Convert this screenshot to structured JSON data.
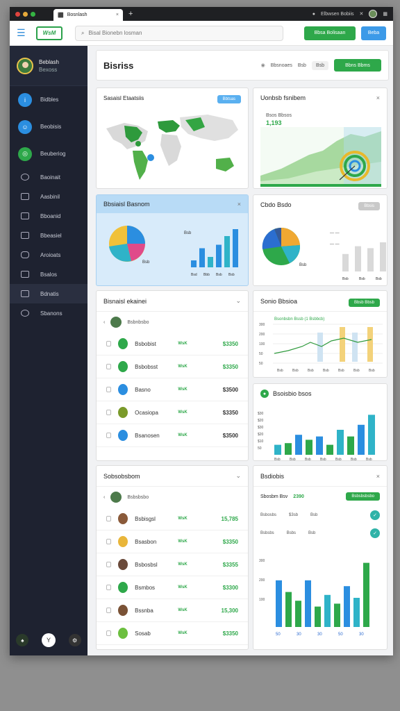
{
  "browser": {
    "tab_title": "Bosnlash",
    "tab_close": "×",
    "new_tab": "+",
    "address_text": "Elbwsen Bobiis"
  },
  "header": {
    "logo_text": "WsM",
    "search_placeholder": "Bisal Bionebn losman",
    "primary_button": "Bbsa Bolisaan",
    "secondary_button": "Beba"
  },
  "sidebar": {
    "user_name": "Beblash",
    "user_role": "Bexoss",
    "items": [
      {
        "label": "Bidbles",
        "icon": "info-icon",
        "color": "#2b8ee0"
      },
      {
        "label": "Beobisis",
        "icon": "users-icon",
        "color": "#2b8ee0"
      },
      {
        "label": "Beuberiog",
        "icon": "chart-icon",
        "color": "#2ea84a"
      },
      {
        "label": "Baoinait",
        "icon": "message-icon"
      },
      {
        "label": "Aasbinil",
        "icon": "card-icon"
      },
      {
        "label": "Bboanid",
        "icon": "file-icon"
      },
      {
        "label": "Bbeasiel",
        "icon": "calendar-icon"
      },
      {
        "label": "Aroioats",
        "icon": "lock-icon"
      },
      {
        "label": "Bsalos",
        "icon": "folder-icon"
      },
      {
        "label": "Bdnatis",
        "icon": "doc-icon"
      },
      {
        "label": "Sbanons",
        "icon": "settings-icon"
      }
    ]
  },
  "topcard": {
    "title": "Bisriss",
    "status": "Bbsnoaes",
    "chip1": "Bsb",
    "chip2": "Bsb",
    "button": "Bbns Bbms"
  },
  "map_card": {
    "title": "Sasaisl Etaatsiis",
    "button": "Bbtsas"
  },
  "area_card": {
    "title": "Uonbsb fsnibem",
    "stat_label": "Bsos Bbsos",
    "stat_value": "1,193",
    "close": "×"
  },
  "pie1_card": {
    "title": "Bbsiaisl Basnom",
    "close": "×",
    "label_top": "Bsb",
    "label_pie": "Bsb",
    "ticks": [
      "Bsd",
      "Bbb",
      "Bsb",
      "Bsb"
    ]
  },
  "pie2_card": {
    "title": "Cbdo Bsdo",
    "button": "Bbsis",
    "label_pie": "Bsb",
    "ticks": [
      "Bsb",
      "Bsb",
      "Bsb"
    ]
  },
  "list1": {
    "title": "Bisnaisl ekainei",
    "sub_label": "Bsbnbsbo",
    "rows": [
      {
        "name": "Bsbobist",
        "badge": "WsK",
        "amount": "$3350",
        "color": "#2ea84a",
        "dark": false
      },
      {
        "name": "Bsbobsst",
        "badge": "WsK",
        "amount": "$3350",
        "color": "#2ea84a",
        "dark": false
      },
      {
        "name": "Basno",
        "badge": "WsK",
        "amount": "$3500",
        "color": "#2b8ee0",
        "dark": true
      },
      {
        "name": "Ocasiopa",
        "badge": "WsK",
        "amount": "$3350",
        "color": "#7a9a2a",
        "dark": true
      },
      {
        "name": "Bsanosen",
        "badge": "WsK",
        "amount": "$3500",
        "color": "#2b8ee0",
        "dark": true
      }
    ]
  },
  "combo_card": {
    "title": "Sonio Bbsioa",
    "button": "Bbsb Bbsb",
    "legend": "Bsonbsbn Bssb (1 Bsbbcb)",
    "y_ticks": [
      "300",
      "200",
      "100",
      "50",
      "50"
    ],
    "x_ticks": [
      "Bsb",
      "Bsb",
      "Bsb",
      "Bsb",
      "Bsb",
      "Bsb",
      "Bsb"
    ]
  },
  "bar1_card": {
    "title": "Bsoisbio bsos",
    "y_ticks": [
      "$30",
      "$20",
      "$30",
      "$20",
      "$10",
      "50"
    ],
    "x_ticks": [
      "Bsb",
      "Bsb",
      "Bsb",
      "Bsb",
      "Bsb",
      "Bsb",
      "Bsb"
    ]
  },
  "list2": {
    "title": "Sobsobsbom",
    "sub_label": "Bsbsbsbo",
    "rows": [
      {
        "name": "Bsbisgsl",
        "badge": "WsK",
        "amount": "15,785",
        "color": "#8a5a3a"
      },
      {
        "name": "Bsasbon",
        "badge": "WsK",
        "amount": "$3350",
        "color": "#e9b63a"
      },
      {
        "name": "Bsbosbsl",
        "badge": "WsK",
        "amount": "$3355",
        "color": "#6a4a3a"
      },
      {
        "name": "Bsmbos",
        "badge": "WsK",
        "amount": "$3300",
        "color": "#2ea84a"
      },
      {
        "name": "Bssnba",
        "badge": "WsK",
        "amount": "15,300",
        "color": "#7a5236"
      },
      {
        "name": "Sosab",
        "badge": "WsK",
        "amount": "$3350",
        "color": "#6cbf3f"
      }
    ]
  },
  "bar2_card": {
    "title": "Bsdiobis",
    "close": "×",
    "stat_label": "Sbosbm Bsv",
    "stat_value": "2390",
    "button": "Bsbsbsbsbo",
    "row1_a": "Bsbosbs",
    "row1_b": "$3sb",
    "row1_c": "Bsb",
    "row2_a": "Bsbsbs",
    "row2_b": "Bsbs",
    "row2_c": "Bsb",
    "y_ticks": [
      "300",
      "200",
      "100"
    ],
    "x_ticks": [
      "50",
      "30",
      "30",
      "50",
      "30"
    ]
  },
  "chart_data": [
    {
      "type": "bar",
      "categories": [
        "Bsd",
        "Bbb",
        "Bsb",
        "Bsb"
      ],
      "values": [
        20,
        55,
        30,
        65,
        90,
        110
      ]
    },
    {
      "type": "bar",
      "values": [
        90,
        130,
        120,
        150
      ]
    },
    {
      "type": "bar",
      "categories": [
        "Bsb",
        "Bsb",
        "Bsb",
        "Bsb",
        "Bsb",
        "Bsb",
        "Bsb"
      ],
      "values": [
        60,
        70,
        120,
        90,
        110,
        60,
        150,
        110,
        180,
        240
      ]
    },
    {
      "type": "bar",
      "values": [
        160,
        120,
        90,
        160,
        70,
        110,
        80,
        140,
        100,
        220
      ]
    }
  ]
}
